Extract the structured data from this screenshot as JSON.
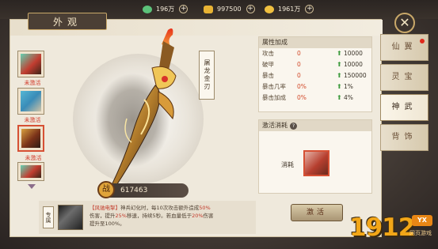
{
  "currencies": [
    {
      "icon": "jade-icon",
      "value": "196万"
    },
    {
      "icon": "gold-ingot-icon",
      "value": "997500"
    },
    {
      "icon": "coin-icon",
      "value": "1961万"
    }
  ],
  "panel": {
    "title": "外观"
  },
  "items": [
    {
      "status": "未激活"
    },
    {
      "status": "未激活"
    },
    {
      "status": "未激活"
    },
    {
      "status": "未激活"
    }
  ],
  "weapon": {
    "name": "屠龙金刃",
    "power": "617463",
    "power_badge": "战"
  },
  "skill": {
    "tag": "专属",
    "name": "【风驰电掣】",
    "line1_a": "神兵幻化时，每10次攻击额外造成",
    "line1_pct": "50%",
    "line2_a": "伤害，提升",
    "line2_pct": "25%",
    "line2_b": "移速，持续5秒。若血量低于",
    "line2_pct2": "20%",
    "line2_c": "伤害",
    "line3": "提升至100%。"
  },
  "attributes": {
    "header": "属性加成",
    "rows": [
      {
        "name": "攻击",
        "value": "0",
        "gain": "10000"
      },
      {
        "name": "破甲",
        "value": "0",
        "gain": "10000"
      },
      {
        "name": "暴击",
        "value": "0",
        "gain": "150000"
      },
      {
        "name": "暴击几率",
        "value": "0%",
        "gain": "1%"
      },
      {
        "name": "暴击加成",
        "value": "0%",
        "gain": "4%"
      }
    ]
  },
  "consume": {
    "header": "激活消耗",
    "help": "?",
    "label": "消耗"
  },
  "activate_button": "激活",
  "tabs": [
    {
      "label": "仙翼",
      "active": false,
      "dot": true
    },
    {
      "label": "灵宝",
      "active": false,
      "dot": false
    },
    {
      "label": "神武",
      "active": true,
      "dot": false
    },
    {
      "label": "背饰",
      "active": false,
      "dot": false
    }
  ],
  "watermark": {
    "digits": "1912",
    "badge": "YX",
    "sub": "网页游戏"
  },
  "colors": {
    "accent_red": "#d65034",
    "gain_green": "#3c9a3c",
    "gold": "#f2a618"
  }
}
